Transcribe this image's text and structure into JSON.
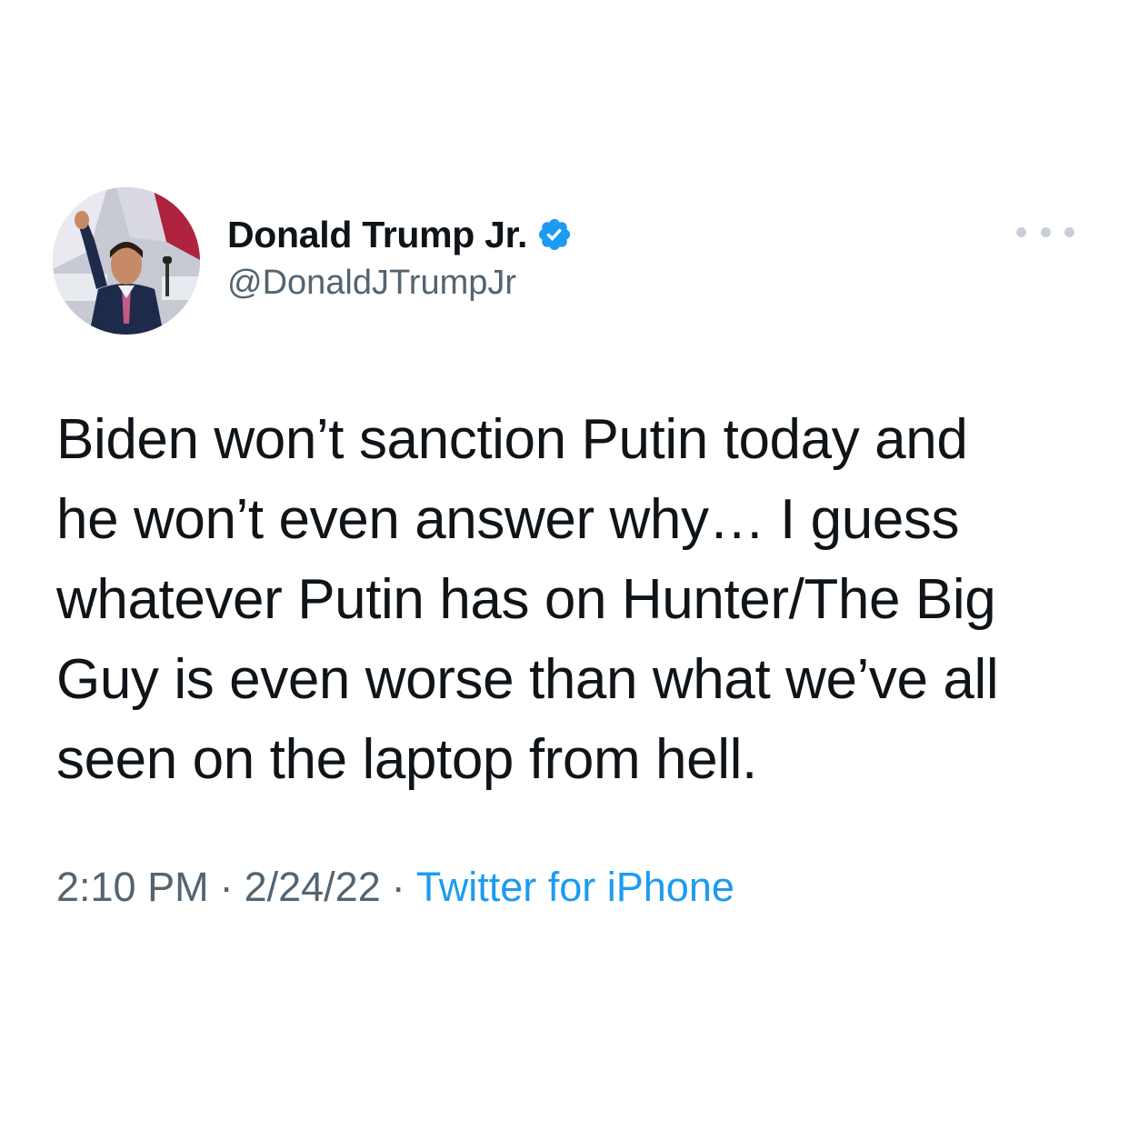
{
  "author": {
    "display_name": "Donald Trump Jr.",
    "handle": "@DonaldJTrumpJr",
    "verified": true,
    "avatar_icon": "profile-photo"
  },
  "tweet": {
    "text_lines": [
      "Biden won’t sanction Putin today and",
      "he won’t even answer why… I guess",
      "whatever Putin has on Hunter/The Big",
      "Guy is even worse than what we’ve all",
      "seen on the laptop from hell."
    ]
  },
  "meta": {
    "time": "2:10 PM",
    "date": "2/24/22",
    "separator": "·",
    "source": "Twitter for iPhone"
  },
  "colors": {
    "text": "#0f1419",
    "secondary": "#536471",
    "accent": "#1d9bf0",
    "more_dots": "#c9cfd6"
  },
  "icons": {
    "verified": "verified-badge-icon",
    "more": "more-options-icon"
  }
}
